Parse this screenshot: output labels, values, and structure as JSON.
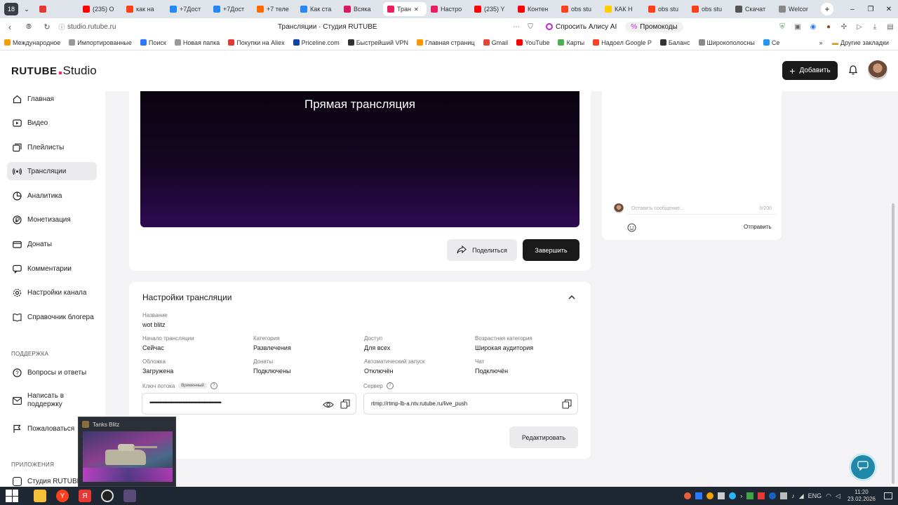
{
  "browser": {
    "tabs": [
      {
        "label": "",
        "color": "#e53935"
      },
      {
        "label": "(235) О",
        "color": "#ff0000"
      },
      {
        "label": "как на",
        "color": "#fc3f1d"
      },
      {
        "label": "+7Дост",
        "color": "#2787f5"
      },
      {
        "label": "+7Дост",
        "color": "#2787f5"
      },
      {
        "label": "+7 телe",
        "color": "#ff6a00"
      },
      {
        "label": "Как ста",
        "color": "#2787f5"
      },
      {
        "label": "Всяка",
        "color": "#d81b60"
      },
      {
        "label": "Тран",
        "color": "#e91e63",
        "active": true
      },
      {
        "label": "Настро",
        "color": "#e91e63"
      },
      {
        "label": "(235) Y",
        "color": "#ff0000"
      },
      {
        "label": "Контен",
        "color": "#ff0000"
      },
      {
        "label": "obs stu",
        "color": "#fc3f1d"
      },
      {
        "label": "КАК Н",
        "color": "#ffcc00"
      },
      {
        "label": "obs stu",
        "color": "#fc3f1d"
      },
      {
        "label": "obs stu",
        "color": "#fc3f1d"
      },
      {
        "label": "Скачат",
        "color": "#555555"
      },
      {
        "label": "Welcor",
        "color": "#888888"
      }
    ],
    "url": "studio.rutube.ru",
    "page_title": "Трансляции · Студия RUTUBE",
    "alice_label": "Спросить Алису AI",
    "promo_label": "Промокоды",
    "bookmarks": [
      {
        "label": "Международное",
        "color": "#f4a000"
      },
      {
        "label": "Импортированные",
        "color": "#999999"
      },
      {
        "label": "Поиск",
        "color": "#2979ff"
      },
      {
        "label": "Новая папка",
        "color": "#999999"
      },
      {
        "label": "Покупки на Aliex",
        "color": "#e53935"
      },
      {
        "label": "Priceline.com",
        "color": "#0d47a1"
      },
      {
        "label": "Быстрейший VPN",
        "color": "#333333"
      },
      {
        "label": "Главная страниц",
        "color": "#ff9800"
      },
      {
        "label": "Gmail",
        "color": "#ea4335"
      },
      {
        "label": "YouTube",
        "color": "#ff0000"
      },
      {
        "label": "Карты",
        "color": "#4caf50"
      },
      {
        "label": "Надоел Google P",
        "color": "#fc3f1d"
      },
      {
        "label": "Баланс",
        "color": "#333333"
      },
      {
        "label": "Широкополосны",
        "color": "#888888"
      },
      {
        "label": "Се",
        "color": "#2196f3"
      }
    ],
    "other_bookmarks": "Другие закладки"
  },
  "app": {
    "logo_main": "RUTUBE",
    "logo_sub": "Studio",
    "add_button": "Добавить",
    "brand_color": "#1a1a1a",
    "accent_color": "#ff2d55"
  },
  "sidebar": {
    "items": [
      {
        "label": "Главная",
        "icon": "home-icon"
      },
      {
        "label": "Видео",
        "icon": "video-icon"
      },
      {
        "label": "Плейлисты",
        "icon": "playlist-icon"
      },
      {
        "label": "Трансляции",
        "icon": "broadcast-icon",
        "active": true
      },
      {
        "label": "Аналитика",
        "icon": "analytics-icon"
      },
      {
        "label": "Монетизация",
        "icon": "ruble-icon"
      },
      {
        "label": "Донаты",
        "icon": "donate-icon"
      },
      {
        "label": "Комментарии",
        "icon": "comment-icon"
      },
      {
        "label": "Настройки канала",
        "icon": "gear-icon"
      },
      {
        "label": "Справочник блогера",
        "icon": "book-icon"
      }
    ],
    "support_label": "ПОДДЕРЖКА",
    "support_items": [
      {
        "label": "Вопросы и ответы",
        "icon": "question-icon"
      },
      {
        "label": "Написать в поддержку",
        "icon": "mail-icon"
      },
      {
        "label": "Пожаловаться",
        "icon": "flag-icon"
      }
    ],
    "apps_label": "ПРИЛОЖЕНИЯ",
    "apps_item": "Студия RUTUBE"
  },
  "player": {
    "title": "Прямая трансляция",
    "share_label": "Поделиться",
    "finish_label": "Завершить"
  },
  "chat": {
    "placeholder": "Оставить сообщение...",
    "counter": "0/200",
    "send_label": "Отправить"
  },
  "settings": {
    "title": "Настройки трансляции",
    "name_label": "Название",
    "name_value": "wot blitz",
    "fields_row1": [
      {
        "label": "Начало трансляции",
        "value": "Сейчас"
      },
      {
        "label": "Категория",
        "value": "Развлечения"
      },
      {
        "label": "Доступ",
        "value": "Для всех"
      },
      {
        "label": "Возрастная категория",
        "value": "Широкая аудитория"
      }
    ],
    "fields_row2": [
      {
        "label": "Обложка",
        "value": "Загружена"
      },
      {
        "label": "Донаты",
        "value": "Подключены"
      },
      {
        "label": "Автоматический запуск",
        "value": "Отключён"
      },
      {
        "label": "Чат",
        "value": "Подключён"
      }
    ],
    "stream_key_label": "Ключ потока",
    "stream_key_badge": "Временный",
    "stream_key_value": "••••••••••••••••••••••••••••••••••••••••••••••••••••••••••",
    "server_label": "Сервер",
    "server_value": "rtmp://rtmp-lb-a.ntv.rutube.ru/live_push",
    "edit_label": "Редактировать"
  },
  "taskbar": {
    "preview_title": "Tanks Blitz",
    "lang": "ENG",
    "time": "11:20",
    "date": "23.02.2026"
  }
}
